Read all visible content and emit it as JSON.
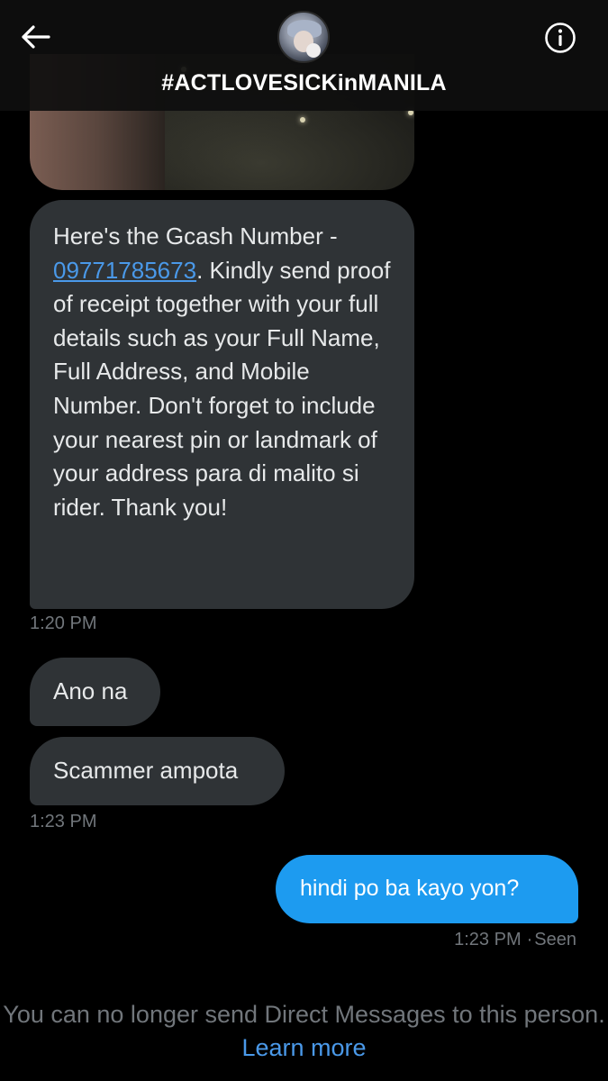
{
  "header": {
    "title": "#ACTLOVESICKinMANILA",
    "back_icon": "arrow-left-icon",
    "info_icon": "info-circle-icon"
  },
  "messages": {
    "received_1": {
      "text_before": "Here's the Gcash Number - ",
      "number": "09771785673",
      "text_after": ". Kindly send proof of receipt together with your full details such as your Full Name, Full Address, and Mobile Number. Don't forget to include your nearest pin or landmark of your address para di malito si rider. Thank you!"
    },
    "time_1": "1:20 PM",
    "received_2": "Ano na",
    "received_3": "Scammer ampota",
    "time_2": "1:23 PM",
    "sent_1": "hindi po ba kayo yon?",
    "time_3": "1:23 PM",
    "sent_status": "Seen"
  },
  "footer": {
    "notice": "You can no longer send Direct Messages to this person.",
    "learn_more": "Learn more"
  },
  "colors": {
    "background": "#000000",
    "received_bubble": "#2f3336",
    "sent_bubble": "#1d9bf0",
    "link": "#4a99e9",
    "muted_text": "#71767b"
  }
}
